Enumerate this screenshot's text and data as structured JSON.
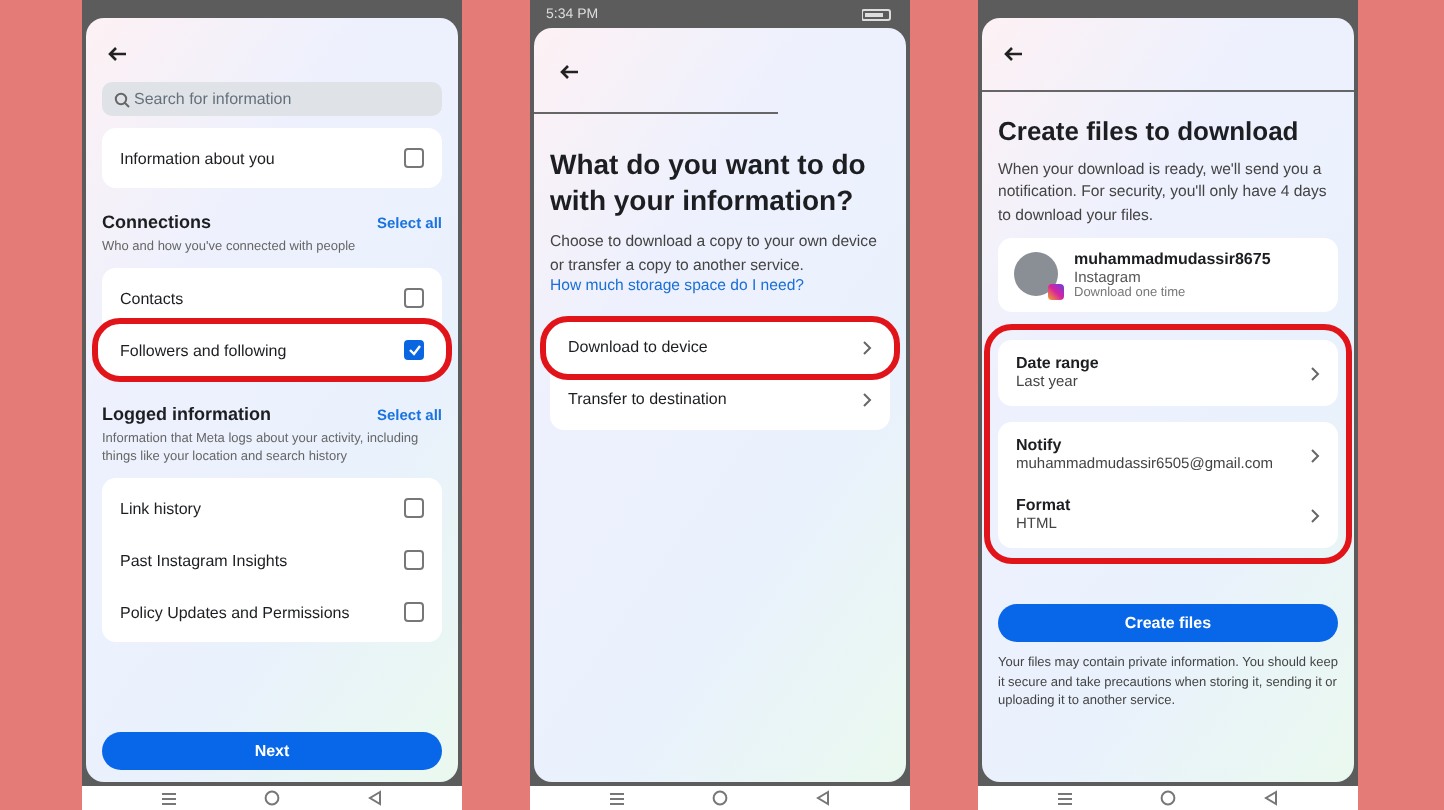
{
  "screens": [
    {
      "kind": "select",
      "search": {
        "placeholder": "Search for information"
      },
      "top_items": [
        {
          "label": "Information about you",
          "checked": false
        }
      ],
      "sections": [
        {
          "title": "Connections",
          "action": "Select all",
          "description": "Who and how you've connected with people",
          "items": [
            {
              "label": "Contacts",
              "checked": false,
              "highlighted": false
            },
            {
              "label": "Followers and following",
              "checked": true,
              "highlighted": true
            }
          ]
        },
        {
          "title": "Logged information",
          "action": "Select all",
          "description": "Information that Meta logs about your activity, including things like your location and search history",
          "items": [
            {
              "label": "Link history",
              "checked": false,
              "highlighted": false
            },
            {
              "label": "Past Instagram Insights",
              "checked": false,
              "highlighted": false
            },
            {
              "label": "Policy Updates and Permissions",
              "checked": false,
              "highlighted": false
            }
          ]
        }
      ],
      "button": "Next"
    },
    {
      "kind": "destination",
      "status_time": "5:34 PM",
      "title": "What do you want to do with your information?",
      "description": "Choose to download a copy to your own device or transfer a copy to another service.",
      "link": "How much storage space do I need?",
      "options": [
        {
          "label": "Download to device",
          "highlighted": true
        },
        {
          "label": "Transfer to destination",
          "highlighted": false
        }
      ]
    },
    {
      "kind": "create",
      "title": "Create files to download",
      "description": "When your download is ready, we'll send you a notification. For security, you'll only have 4 days to download your files.",
      "account": {
        "username": "muhammadmudassir8675",
        "platform": "Instagram",
        "note": "Download one time"
      },
      "settings_highlighted": true,
      "setting_groups": [
        {
          "items": [
            {
              "label": "Date range",
              "value": "Last year"
            }
          ]
        },
        {
          "items": [
            {
              "label": "Notify",
              "value": "muhammadmudassir6505@gmail.com"
            },
            {
              "label": "Format",
              "value": "HTML"
            }
          ]
        }
      ],
      "button": "Create files",
      "footnote": "Your files may contain private information. You should keep it secure and take precautions when storing it, sending it or uploading it to another service."
    }
  ]
}
